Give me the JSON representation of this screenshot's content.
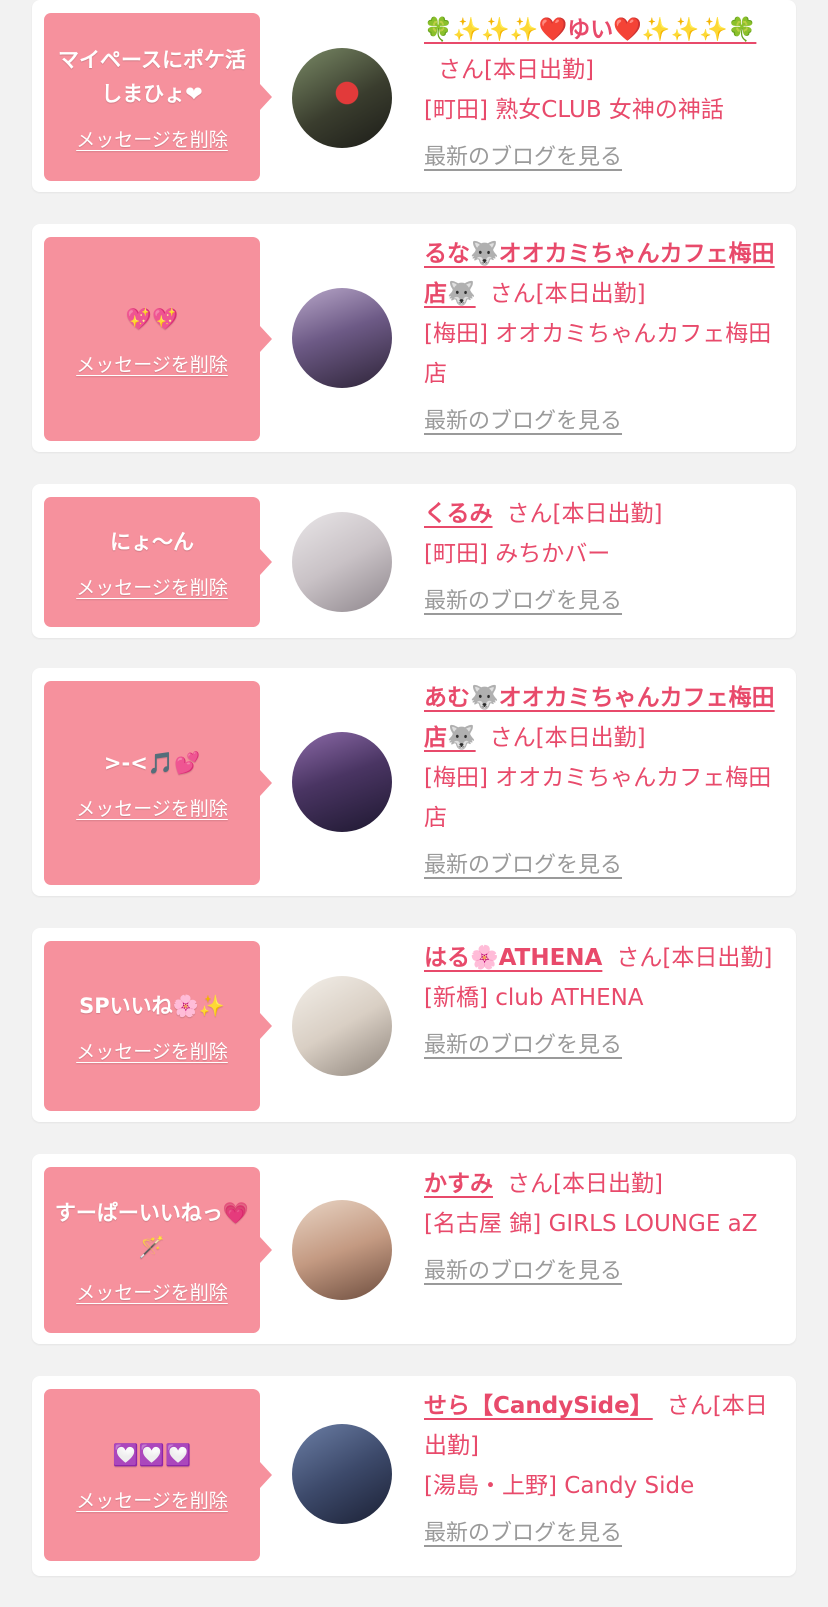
{
  "common": {
    "delete_label": "メッセージを削除",
    "blog_label": "最新のブログを見る",
    "san_suffix": "さん[本日出勤]"
  },
  "entries": [
    {
      "message": "マイペースにポケ活しまひょ❤",
      "girl_name": "🍀✨✨✨❤️ゆい❤️✨✨✨🍀",
      "shop": "[町田] 熟女CLUB 女神の神話"
    },
    {
      "message": "💖💖",
      "girl_name": "るな🐺オオカミちゃんカフェ梅田店🐺",
      "shop": "[梅田] オオカミちゃんカフェ梅田店"
    },
    {
      "message": "にょ〜ん",
      "girl_name": "くるみ",
      "shop": "[町田] みちかバー"
    },
    {
      "message": ">-<🎵💕",
      "girl_name": "あむ🐺オオカミちゃんカフェ梅田店🐺",
      "shop": "[梅田] オオカミちゃんカフェ梅田店"
    },
    {
      "message": "SPいいね🌸✨",
      "girl_name": "はる🌸ATHENA",
      "shop": "[新橋] club ATHENA"
    },
    {
      "message": "すーぱーいいねっ💗🪄",
      "girl_name": "かすみ",
      "shop": "[名古屋 錦] GIRLS LOUNGE aZ"
    },
    {
      "message": "💟💟💟",
      "girl_name": "せら【CandySide】",
      "shop": "[湯島・上野] Candy Side"
    }
  ]
}
